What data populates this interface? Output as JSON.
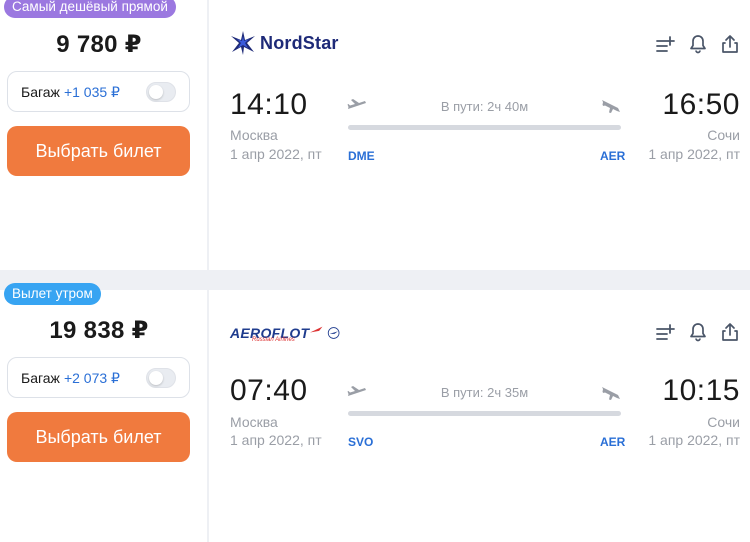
{
  "colors": {
    "accent_orange": "#f07a3e",
    "badge_purple": "#9b78e0",
    "badge_blue": "#37a4f2",
    "link_blue": "#2a6fd6",
    "muted_gray": "#9a9ea6"
  },
  "tickets": [
    {
      "badge": "Самый дешёвый прямой",
      "price": "9 780 ₽",
      "baggage": {
        "label": "Багаж",
        "price": "+1 035 ₽",
        "enabled": false
      },
      "buy_label": "Выбрать билет",
      "airline": {
        "name": "NordStar",
        "logo_icon": "nordstar-star-icon"
      },
      "departure": {
        "time": "14:10",
        "city": "Москва",
        "date": "1 апр 2022, пт",
        "airport": "DME"
      },
      "arrival": {
        "time": "16:50",
        "city": "Сочи",
        "date": "1 апр 2022, пт",
        "airport": "AER"
      },
      "duration": "В пути: 2ч 40м"
    },
    {
      "badge": "Вылет утром",
      "price": "19 838 ₽",
      "baggage": {
        "label": "Багаж",
        "price": "+2 073 ₽",
        "enabled": false
      },
      "buy_label": "Выбрать билет",
      "airline": {
        "name": "AEROFLOT",
        "subtitle": "Russian Airlines",
        "logo_icon": "aeroflot-emblem-icon"
      },
      "departure": {
        "time": "07:40",
        "city": "Москва",
        "date": "1 апр 2022, пт",
        "airport": "SVO"
      },
      "arrival": {
        "time": "10:15",
        "city": "Сочи",
        "date": "1 апр 2022, пт",
        "airport": "AER"
      },
      "duration": "В пути: 2ч 35м"
    }
  ],
  "action_icons": [
    "add-to-list-icon",
    "bell-icon",
    "share-icon"
  ]
}
